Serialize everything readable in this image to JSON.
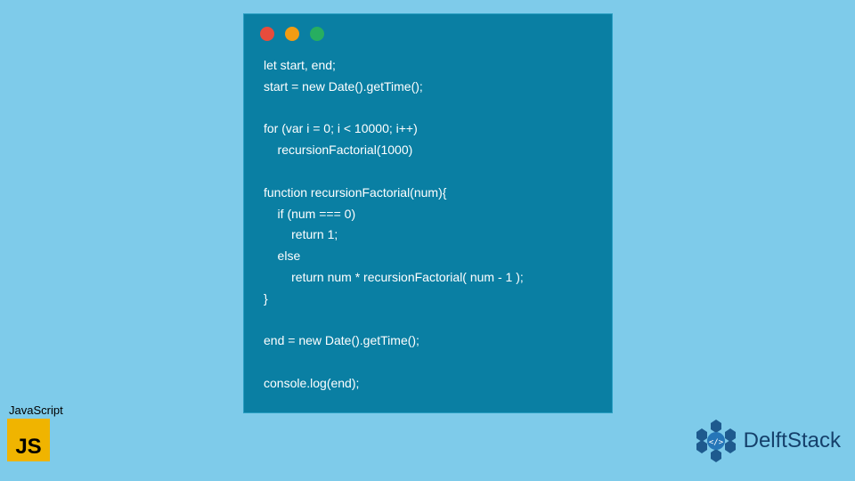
{
  "code": {
    "lines": "let start, end;\nstart = new Date().getTime();\n\nfor (var i = 0; i < 10000; i++)\n    recursionFactorial(1000)\n\nfunction recursionFactorial(num){\n    if (num === 0)\n        return 1;\n    else\n        return num * recursionFactorial( num - 1 );\n}\n\nend = new Date().getTime();\n\nconsole.log(end);"
  },
  "badge": {
    "label": "JavaScript",
    "logo_text": "JS"
  },
  "brand": {
    "name": "DelftStack"
  },
  "colors": {
    "bg": "#7ecbea",
    "window": "#0a7fa3",
    "js_logo": "#f0b400",
    "brand_text": "#15406b"
  }
}
